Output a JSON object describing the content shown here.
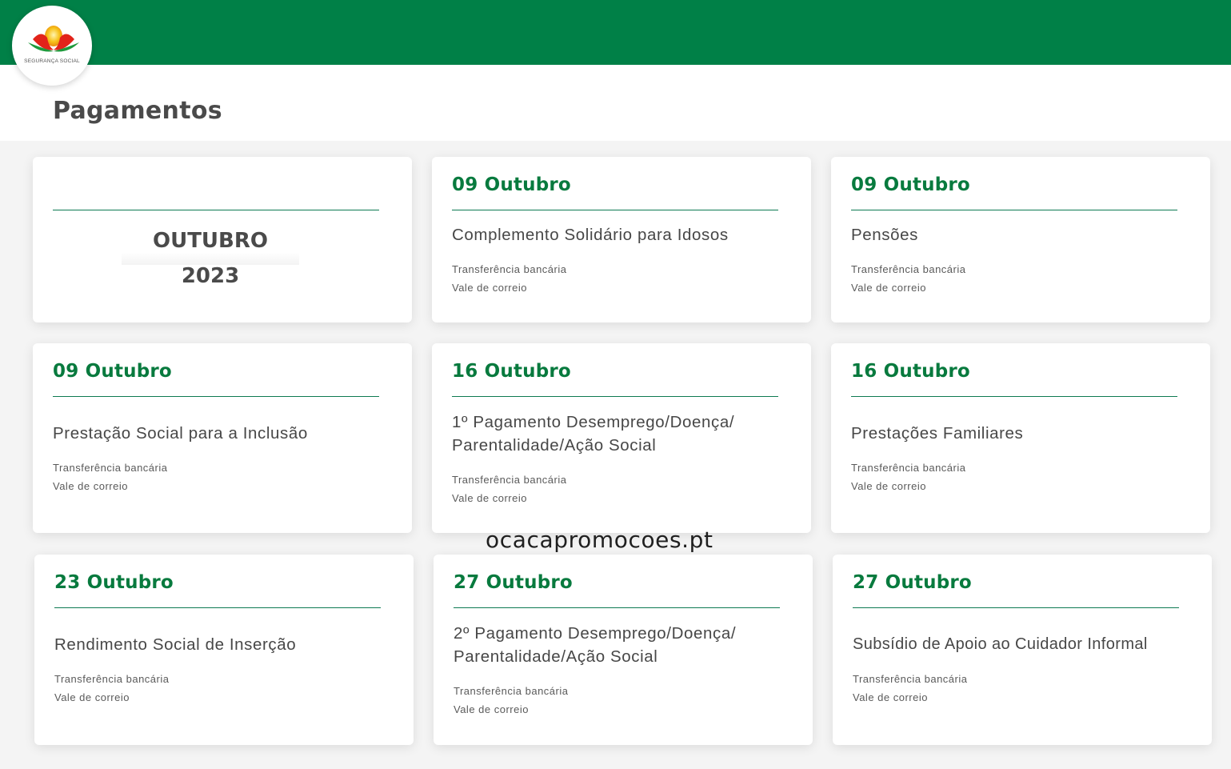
{
  "header": {
    "brand": "SEGURANÇA SOCIAL",
    "brand_color": "#008047"
  },
  "page_title": "Pagamentos",
  "month_label": "OUTUBRO 2023",
  "watermark": "ocacapromocoes.pt",
  "cards": [
    {
      "date": "09 Outubro",
      "title": "Complemento Solidário para Idosos",
      "methods": [
        "Transferência bancária",
        "Vale de correio"
      ]
    },
    {
      "date": "09 Outubro",
      "title": "Pensões",
      "methods": [
        "Transferência bancária",
        "Vale de correio"
      ]
    },
    {
      "date": "09 Outubro",
      "title": "Prestação Social para a Inclusão",
      "methods": [
        "Transferência bancária",
        "Vale de correio"
      ]
    },
    {
      "date": "16 Outubro",
      "title": "1º Pagamento Desemprego/Doença/ Parentalidade/Ação Social",
      "methods": [
        "Transferência bancária",
        "Vale de correio"
      ]
    },
    {
      "date": "16 Outubro",
      "title": "Prestações Familiares",
      "methods": [
        "Transferência bancária",
        "Vale de correio"
      ]
    },
    {
      "date": "23 Outubro",
      "title": "Rendimento Social de Inserção",
      "methods": [
        "Transferência bancária",
        "Vale de correio"
      ]
    },
    {
      "date": "27 Outubro",
      "title": "2º Pagamento Desemprego/Doença/ Parentalidade/Ação Social",
      "methods": [
        "Transferência bancária",
        "Vale de correio"
      ]
    },
    {
      "date": "27 Outubro",
      "title": "Subsídio de Apoio ao Cuidador Informal",
      "methods": [
        "Transferência bancária",
        "Vale de correio"
      ]
    }
  ]
}
